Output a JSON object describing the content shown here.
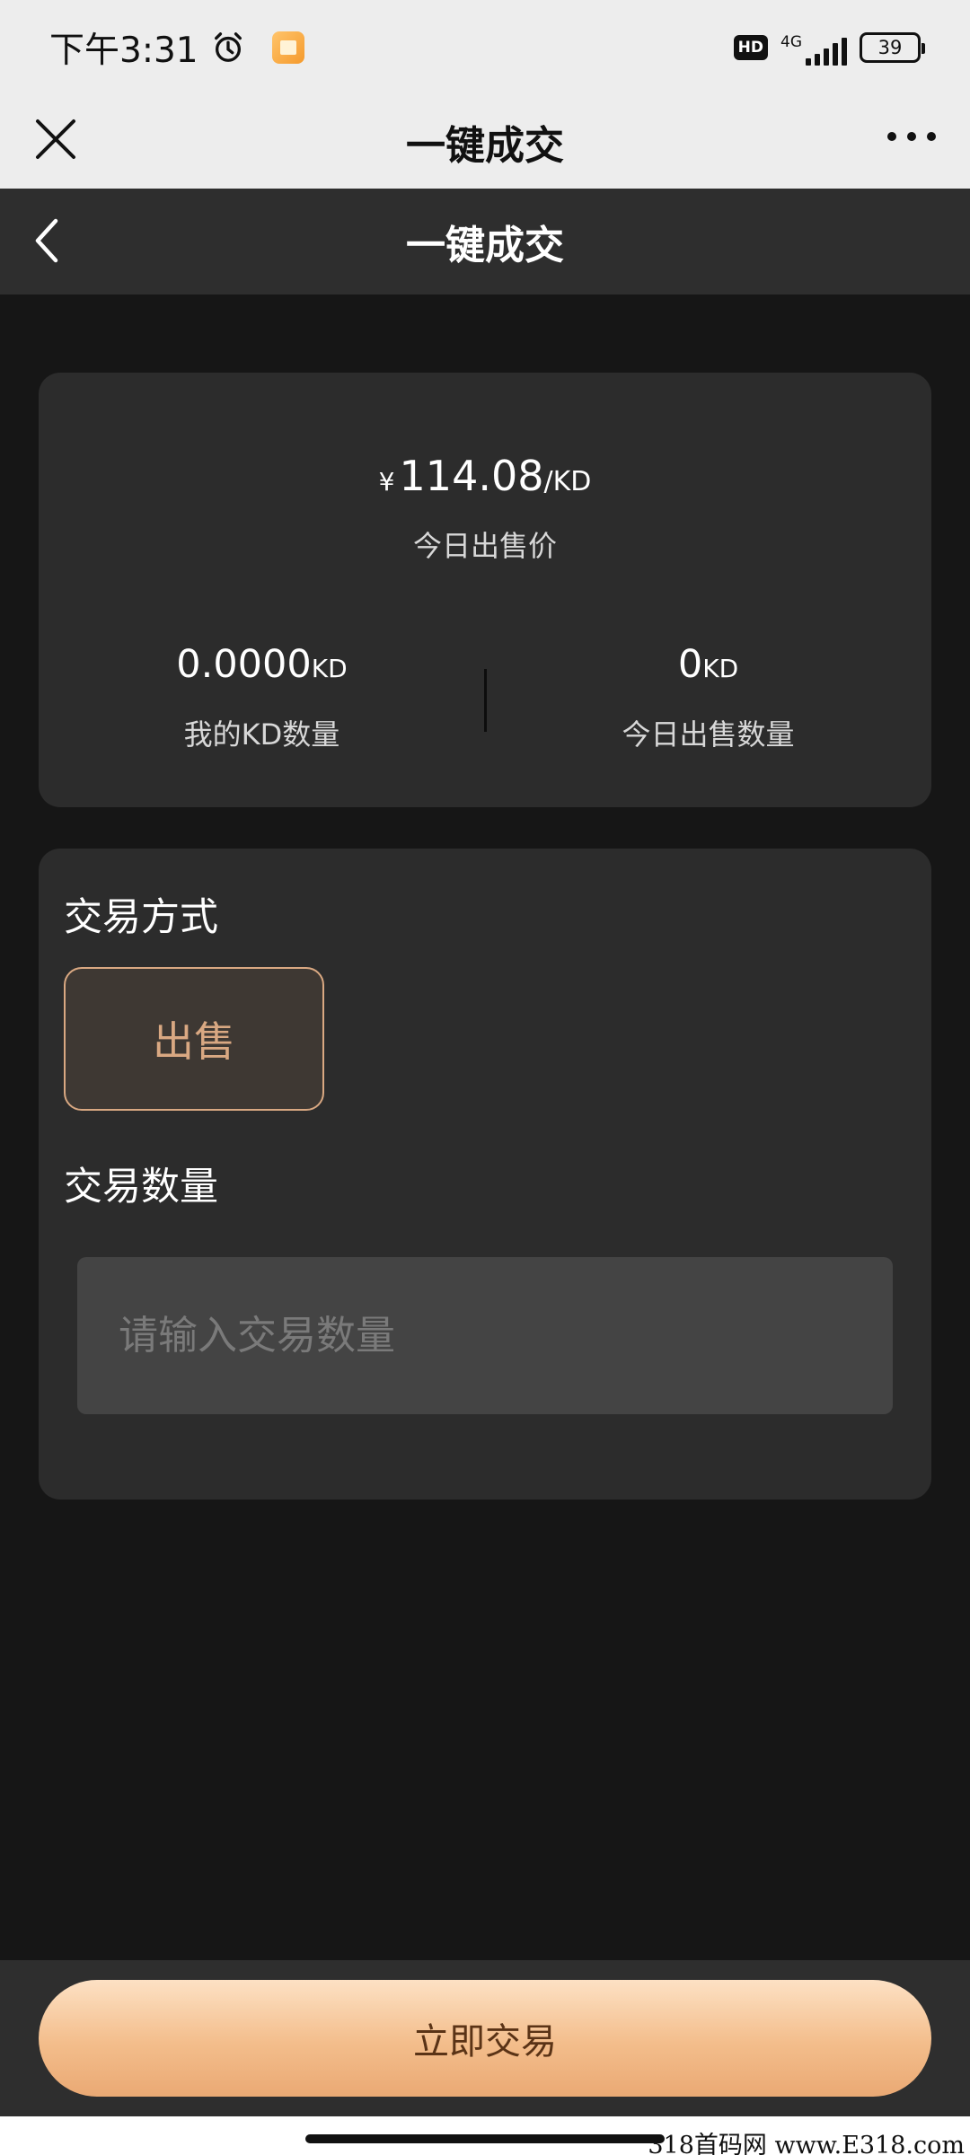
{
  "status_bar": {
    "time": "下午3:31",
    "hd": "HD",
    "network": "4G",
    "battery": "39",
    "icons": [
      "alarm-icon",
      "app-notification-icon",
      "signal-icon",
      "battery-icon"
    ]
  },
  "wx_nav": {
    "title": "一键成交",
    "icons": [
      "close-icon",
      "more-icon"
    ]
  },
  "header": {
    "title": "一键成交",
    "icons": [
      "back-icon"
    ]
  },
  "price": {
    "currency": "¥",
    "value": "114.08",
    "unit": "/KD",
    "label": "今日出售价"
  },
  "stats": {
    "my_kd_value": "0.0000",
    "my_kd_unit": "KD",
    "my_kd_label": "我的KD数量",
    "sold_today_value": "0",
    "sold_today_unit": "KD",
    "sold_today_label": "今日出售数量"
  },
  "trade": {
    "method_label": "交易方式",
    "sell_option": "出售",
    "quantity_label": "交易数量",
    "quantity_placeholder": "请输入交易数量",
    "quantity_value": ""
  },
  "bottom": {
    "submit_label": "立即交易"
  },
  "watermark": "318首码网  www.E318.com",
  "colors": {
    "background": "#161616",
    "card": "#2c2c2c",
    "accent": "#d9a882",
    "button_gradient_top": "#fde1c4",
    "button_gradient_bottom": "#eaa974"
  }
}
